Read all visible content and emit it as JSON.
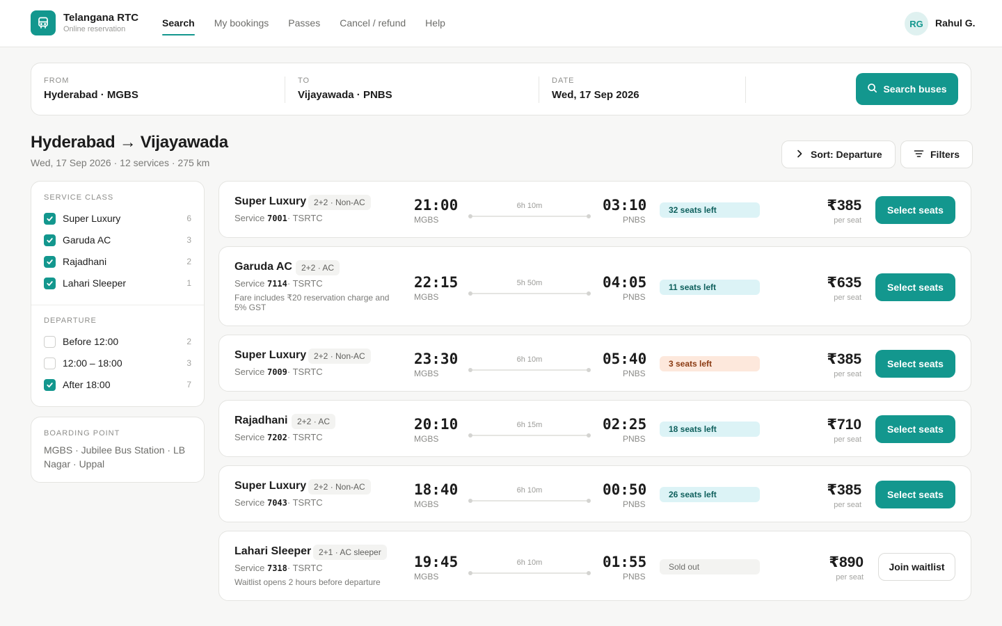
{
  "brand": {
    "name": "Telangana RTC",
    "subtitle": "Online reservation"
  },
  "nav": {
    "items": [
      "Search",
      "My bookings",
      "Passes",
      "Cancel / refund",
      "Help"
    ],
    "active": "Search"
  },
  "user": {
    "initials": "RG",
    "name": "Rahul G."
  },
  "search": {
    "from_label": "FROM",
    "from_value": "Hyderabad · MGBS",
    "to_label": "TO",
    "to_value": "Vijayawada · PNBS",
    "date_label": "DATE",
    "date_value": "Wed, 17 Sep 2026",
    "button_label": "Search buses"
  },
  "results": {
    "title": "Hyderabad → Vijayawada",
    "subtitle": "Wed, 17 Sep 2026 · 12 services · 275 km",
    "sort_label": "Sort: Departure",
    "filters_label": "Filters"
  },
  "filters": {
    "service_class": {
      "label": "SERVICE CLASS",
      "items": [
        {
          "label": "Super Luxury",
          "count": "6",
          "checked": true
        },
        {
          "label": "Garuda AC",
          "count": "3",
          "checked": true
        },
        {
          "label": "Rajadhani",
          "count": "2",
          "checked": true
        },
        {
          "label": "Lahari Sleeper",
          "count": "1",
          "checked": true
        }
      ]
    },
    "departure": {
      "label": "DEPARTURE",
      "items": [
        {
          "label": "Before 12:00",
          "count": "2",
          "checked": false
        },
        {
          "label": "12:00 – 18:00",
          "count": "3",
          "checked": false
        },
        {
          "label": "After 18:00",
          "count": "7",
          "checked": true
        }
      ]
    },
    "boarding": {
      "label": "BOARDING POINT",
      "text": "MGBS · Jubilee Bus Station · LB Nagar · Uppal"
    }
  },
  "buses": [
    {
      "name": "Super Luxury",
      "tag": "2+2 · Non-AC",
      "service_prefix": "Service",
      "service_no": "7001",
      "operator": "· TSRTC",
      "note": "",
      "depart": "21:00",
      "from": "MGBS",
      "duration": "6h 10m",
      "arrive": "03:10",
      "to": "PNBS",
      "seats": "32 seats left",
      "seats_style": "teal",
      "price": "₹385",
      "per_seat": "per seat",
      "action": "Select seats",
      "action_type": "select"
    },
    {
      "name": "Garuda AC",
      "tag": "2+2 · AC",
      "service_prefix": "Service",
      "service_no": "7114",
      "operator": "· TSRTC",
      "note": "Fare includes ₹20 reservation charge and 5% GST",
      "depart": "22:15",
      "from": "MGBS",
      "duration": "5h 50m",
      "arrive": "04:05",
      "to": "PNBS",
      "seats": "11 seats left",
      "seats_style": "teal",
      "price": "₹635",
      "per_seat": "per seat",
      "action": "Select seats",
      "action_type": "select"
    },
    {
      "name": "Super Luxury",
      "tag": "2+2 · Non-AC",
      "service_prefix": "Service",
      "service_no": "7009",
      "operator": "· TSRTC",
      "note": "",
      "depart": "23:30",
      "from": "MGBS",
      "duration": "6h 10m",
      "arrive": "05:40",
      "to": "PNBS",
      "seats": "3 seats left",
      "seats_style": "orange",
      "price": "₹385",
      "per_seat": "per seat",
      "action": "Select seats",
      "action_type": "select"
    },
    {
      "name": "Rajadhani",
      "tag": "2+2 · AC",
      "service_prefix": "Service",
      "service_no": "7202",
      "operator": "· TSRTC",
      "note": "",
      "depart": "20:10",
      "from": "MGBS",
      "duration": "6h 15m",
      "arrive": "02:25",
      "to": "PNBS",
      "seats": "18 seats left",
      "seats_style": "teal",
      "price": "₹710",
      "per_seat": "per seat",
      "action": "Select seats",
      "action_type": "select"
    },
    {
      "name": "Super Luxury",
      "tag": "2+2 · Non-AC",
      "service_prefix": "Service",
      "service_no": "7043",
      "operator": "· TSRTC",
      "note": "",
      "depart": "18:40",
      "from": "MGBS",
      "duration": "6h 10m",
      "arrive": "00:50",
      "to": "PNBS",
      "seats": "26 seats left",
      "seats_style": "teal",
      "price": "₹385",
      "per_seat": "per seat",
      "action": "Select seats",
      "action_type": "select"
    },
    {
      "name": "Lahari Sleeper",
      "tag": "2+1 · AC sleeper",
      "service_prefix": "Service",
      "service_no": "7318",
      "operator": "· TSRTC",
      "note": "Waitlist opens 2 hours before departure",
      "depart": "19:45",
      "from": "MGBS",
      "duration": "6h 10m",
      "arrive": "01:55",
      "to": "PNBS",
      "seats": "Sold out",
      "seats_style": "grey",
      "price": "₹890",
      "per_seat": "per seat",
      "action": "Join waitlist",
      "action_type": "waitlist"
    }
  ],
  "colors": {
    "accent": "#13978e",
    "background": "#f7f7f6",
    "seats_teal_bg": "#dcf3f6",
    "seats_orange_bg": "#fde8dc"
  }
}
